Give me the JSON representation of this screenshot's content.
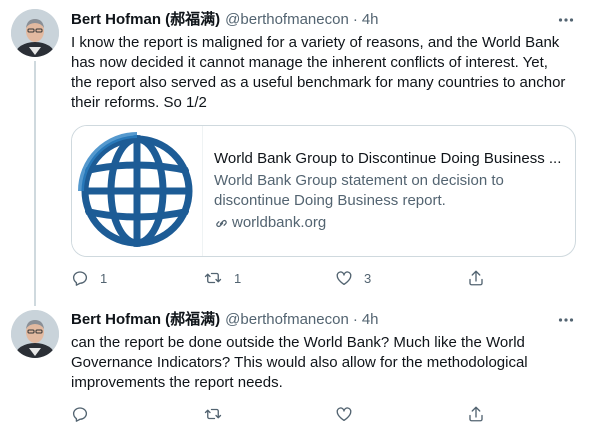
{
  "tweets": [
    {
      "author": {
        "display_name": "Bert Hofman (郝福满)",
        "handle": "@berthofmanecon",
        "time": "4h"
      },
      "text": "I know the report is maligned for a variety of reasons, and the World Bank has now decided it cannot manage the inherent conflicts of interest. Yet, the report also served as a useful benchmark for many countries to anchor their reforms. So 1/2",
      "card": {
        "title": "World Bank Group to Discontinue Doing Business ...",
        "description": "World Bank Group statement on decision to discontinue Doing Business report.",
        "domain": "worldbank.org",
        "thumb_icon": "world-bank-logo-icon"
      },
      "metrics": {
        "replies": "1",
        "retweets": "1",
        "likes": "3"
      }
    },
    {
      "author": {
        "display_name": "Bert Hofman (郝福满)",
        "handle": "@berthofmanecon",
        "time": "4h"
      },
      "text": "can the report be done outside the World Bank?  Much like the World Governance Indicators?  This would also allow for the methodological improvements the report needs.",
      "metrics": {
        "replies": "",
        "retweets": "",
        "likes": ""
      }
    }
  ],
  "ui": {
    "dot": "·"
  },
  "colors": {
    "secondary": "#536471",
    "primary_text": "#0f1419",
    "border": "#cfd9de",
    "logo_blue": "#1a5a96"
  }
}
